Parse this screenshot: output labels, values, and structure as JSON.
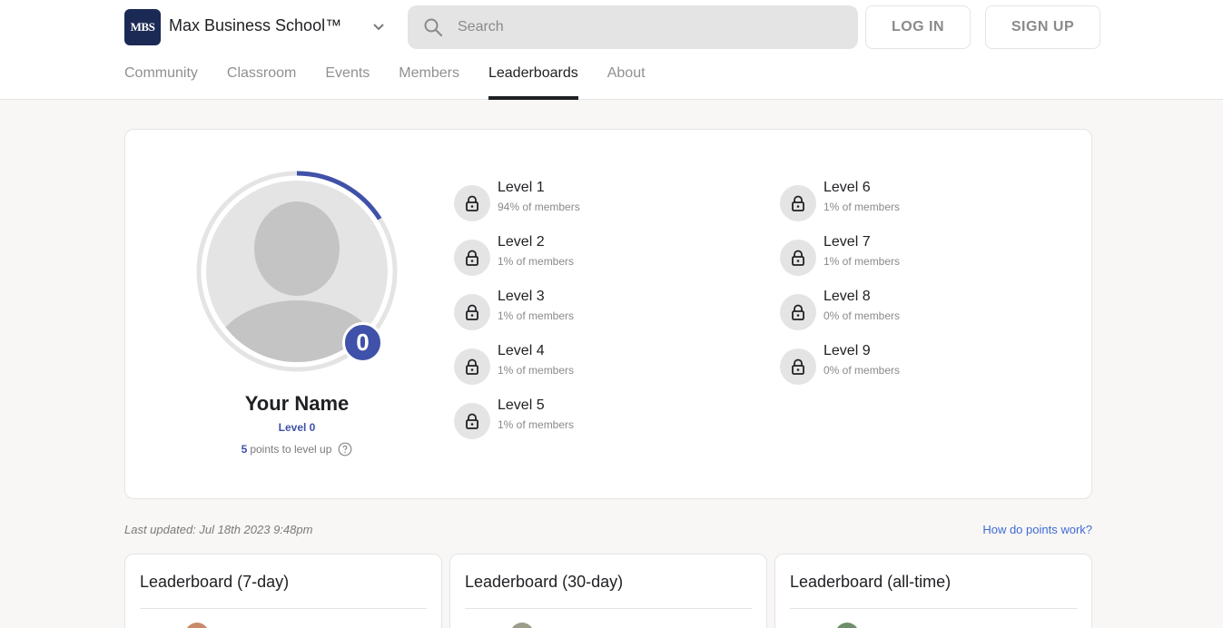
{
  "header": {
    "logo_text": "MBS",
    "group_name": "Max Business School™",
    "search_placeholder": "Search",
    "login_label": "LOG IN",
    "signup_label": "SIGN UP"
  },
  "tabs": [
    {
      "label": "Community"
    },
    {
      "label": "Classroom"
    },
    {
      "label": "Events"
    },
    {
      "label": "Members"
    },
    {
      "label": "Leaderboards"
    },
    {
      "label": "About"
    }
  ],
  "profile": {
    "name": "Your Name",
    "level_label": "Level 0",
    "level_number": "0",
    "points_to_level": "5",
    "points_suffix": "points to level up",
    "progress_fraction": 0.16
  },
  "levels": [
    {
      "title": "Level 1",
      "members": "94% of members"
    },
    {
      "title": "Level 2",
      "members": "1% of members"
    },
    {
      "title": "Level 3",
      "members": "1% of members"
    },
    {
      "title": "Level 4",
      "members": "1% of members"
    },
    {
      "title": "Level 5",
      "members": "1% of members"
    },
    {
      "title": "Level 6",
      "members": "1% of members"
    },
    {
      "title": "Level 7",
      "members": "1% of members"
    },
    {
      "title": "Level 8",
      "members": "0% of members"
    },
    {
      "title": "Level 9",
      "members": "0% of members"
    }
  ],
  "last_updated": "Last updated: Jul 18th 2023 9:48pm",
  "how_points_link": "How do points work?",
  "leaderboards": [
    {
      "title": "Leaderboard (7-day)"
    },
    {
      "title": "Leaderboard (30-day)"
    },
    {
      "title": "Leaderboard (all-time)"
    }
  ],
  "colors": {
    "accent": "#3f51a8",
    "logo_bg": "#1b2a55",
    "link": "#3f6bd6"
  }
}
